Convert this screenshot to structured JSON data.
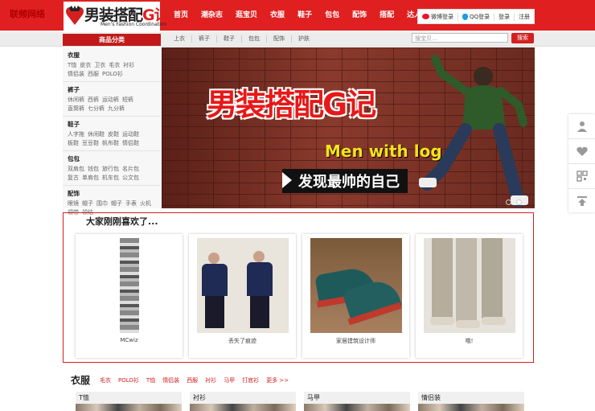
{
  "site": {
    "corner_label": "联频网络",
    "logo_main": "男装搭配",
    "logo_g": "G记",
    "logo_sub": "Men's Fashion Coordination"
  },
  "nav": {
    "items": [
      "首页",
      "潮杂志",
      "逛宝贝",
      "衣服",
      "鞋子",
      "包包",
      "配饰",
      "搭配",
      "达人"
    ],
    "weibo_login": "微博登录",
    "qq_login": "QQ登录",
    "login": "登录",
    "register": "注册"
  },
  "subbar": {
    "category_title": "商品分类",
    "links": [
      "上衣",
      "裤子",
      "鞋子",
      "包包",
      "配饰",
      "护肤"
    ],
    "search_placeholder": "搜宝贝...",
    "search_button": "搜索"
  },
  "sidebar": {
    "groups": [
      {
        "title": "衣服",
        "items": [
          "T恤",
          "皮衣",
          "卫衣",
          "毛衣",
          "衬衫",
          "情侣装",
          "西服",
          "POLO衫"
        ]
      },
      {
        "title": "裤子",
        "items": [
          "休闲裤",
          "西裤",
          "运动裤",
          "短裤",
          "直筒裤",
          "七分裤",
          "九分裤"
        ]
      },
      {
        "title": "鞋子",
        "items": [
          "人字拖",
          "休闲鞋",
          "皮鞋",
          "运动鞋",
          "板鞋",
          "豆豆鞋",
          "帆布鞋",
          "情侣鞋"
        ]
      },
      {
        "title": "包包",
        "items": [
          "双肩包",
          "钱包",
          "旅行包",
          "名片包",
          "复古",
          "单肩包",
          "机车包",
          "公文包"
        ]
      },
      {
        "title": "配饰",
        "items": [
          "眼镜",
          "帽子",
          "围巾",
          "帽子",
          "手表",
          "火机",
          "领带",
          "领结"
        ]
      }
    ]
  },
  "banner": {
    "title": "男装搭配G记",
    "english": "Men with log",
    "slogan": "发现最帅的自己",
    "slide_count": 2,
    "active_slide": 2
  },
  "liked": {
    "title": "大家刚刚喜欢了...",
    "cards": [
      {
        "caption": "MCwiz"
      },
      {
        "caption": "丢失了痕迹"
      },
      {
        "caption": "家居建筑设计师"
      },
      {
        "caption": "哦!"
      }
    ]
  },
  "clothes_section": {
    "title": "衣服",
    "tags": [
      "毛衣",
      "POLO衫",
      "T恤",
      "情侣装",
      "西服",
      "衬衫",
      "马甲",
      "打底衫",
      "更多 >>"
    ],
    "subcategories": [
      "T恤",
      "衬衫",
      "马甲",
      "情侣装"
    ]
  },
  "colors": {
    "brand_red": "#e02020",
    "button_red": "#d42020"
  }
}
